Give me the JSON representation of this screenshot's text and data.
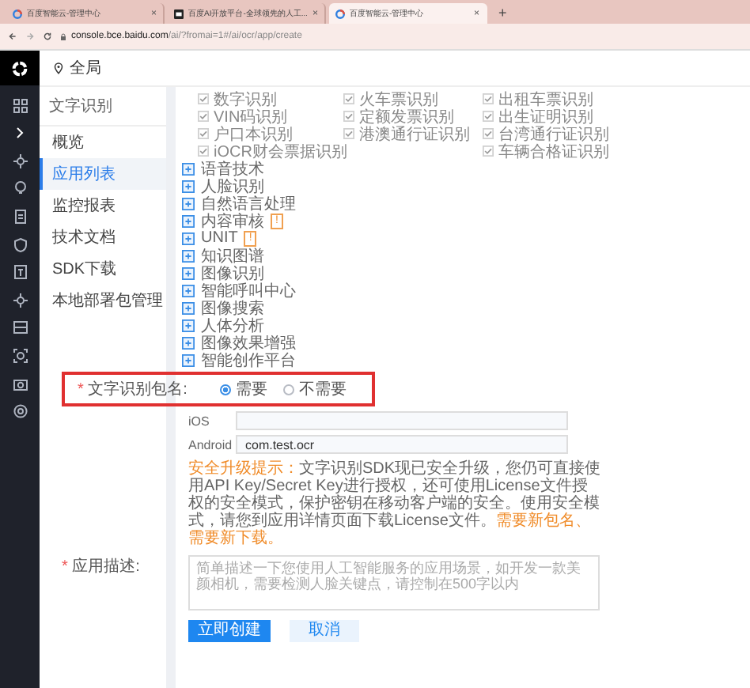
{
  "browser": {
    "tabs": [
      {
        "title": "百度智能云-管理中心",
        "kind": "cloud",
        "close": "×",
        "selected": false
      },
      {
        "title": "百度AI开放平台-全球领先的人工...",
        "kind": "ai",
        "close": "×",
        "selected": false
      },
      {
        "title": "百度智能云-管理中心",
        "kind": "cloud",
        "close": "×",
        "selected": true
      }
    ],
    "new_tab": "+",
    "address": {
      "host": "console.bce.baidu.com",
      "path": "/ai/?fromai=1#/ai/ocr/app/create"
    }
  },
  "header": {
    "region": "全局"
  },
  "sidebar": {
    "title": "文字识别",
    "items": [
      {
        "label": "概览",
        "selected": false
      },
      {
        "label": "应用列表",
        "selected": true
      },
      {
        "label": "监控报表",
        "selected": false
      },
      {
        "label": "技术文档",
        "selected": false
      },
      {
        "label": "SDK下载",
        "selected": false
      },
      {
        "label": "本地部署包管理",
        "selected": false
      }
    ]
  },
  "capability_columns": [
    [
      {
        "label": "数字识别",
        "checked": true
      },
      {
        "label": "VIN码识别",
        "checked": true
      },
      {
        "label": "户口本识别",
        "checked": true
      },
      {
        "label": "iOCR财会票据识别",
        "checked": true
      }
    ],
    [
      {
        "label": "火车票识别",
        "checked": true
      },
      {
        "label": "定额发票识别",
        "checked": true
      },
      {
        "label": "港澳通行证识别",
        "checked": true
      }
    ],
    [
      {
        "label": "出租车票识别",
        "checked": true
      },
      {
        "label": "出生证明识别",
        "checked": true
      },
      {
        "label": "台湾通行证识别",
        "checked": true
      },
      {
        "label": "车辆合格证识别",
        "checked": true
      }
    ]
  ],
  "services": [
    {
      "label": "语音技术"
    },
    {
      "label": "人脸识别"
    },
    {
      "label": "自然语言处理"
    },
    {
      "label": "内容审核",
      "badge": "!"
    },
    {
      "label": "UNIT",
      "badge": "!"
    },
    {
      "label": "知识图谱"
    },
    {
      "label": "图像识别"
    },
    {
      "label": "智能呼叫中心"
    },
    {
      "label": "图像搜索"
    },
    {
      "label": "人体分析"
    },
    {
      "label": "图像效果增强"
    },
    {
      "label": "智能创作平台"
    }
  ],
  "package_name": {
    "required": "*",
    "label": "文字识别包名:",
    "options": [
      {
        "label": "需要",
        "selected": true
      },
      {
        "label": "不需要",
        "selected": false
      }
    ],
    "fields": [
      {
        "label": "iOS"
      },
      {
        "label": "Android",
        "value": "com.test.ocr"
      }
    ]
  },
  "note": {
    "prefix": "安全升级提示：",
    "body": "文字识别SDK现已安全升级，您仍可直接使用API Key/Secret Key进行授权，还可使用License文件授权的安全模式，保护密钥在移动客户端的安全。使用安全模式，请您到应用详情页面下载License文件。",
    "suffix": "需要新包名、需要新下载。"
  },
  "description": {
    "required": "*",
    "label": "应用描述:",
    "placeholder": "简单描述一下您使用人工智能服务的应用场景，如开发一款美颜相机，需要检测人脸关键点，请控制在500字以内"
  },
  "buttons": [
    {
      "label": "立即创建",
      "kind": "primary"
    },
    {
      "label": "取消",
      "kind": "secondary"
    }
  ]
}
